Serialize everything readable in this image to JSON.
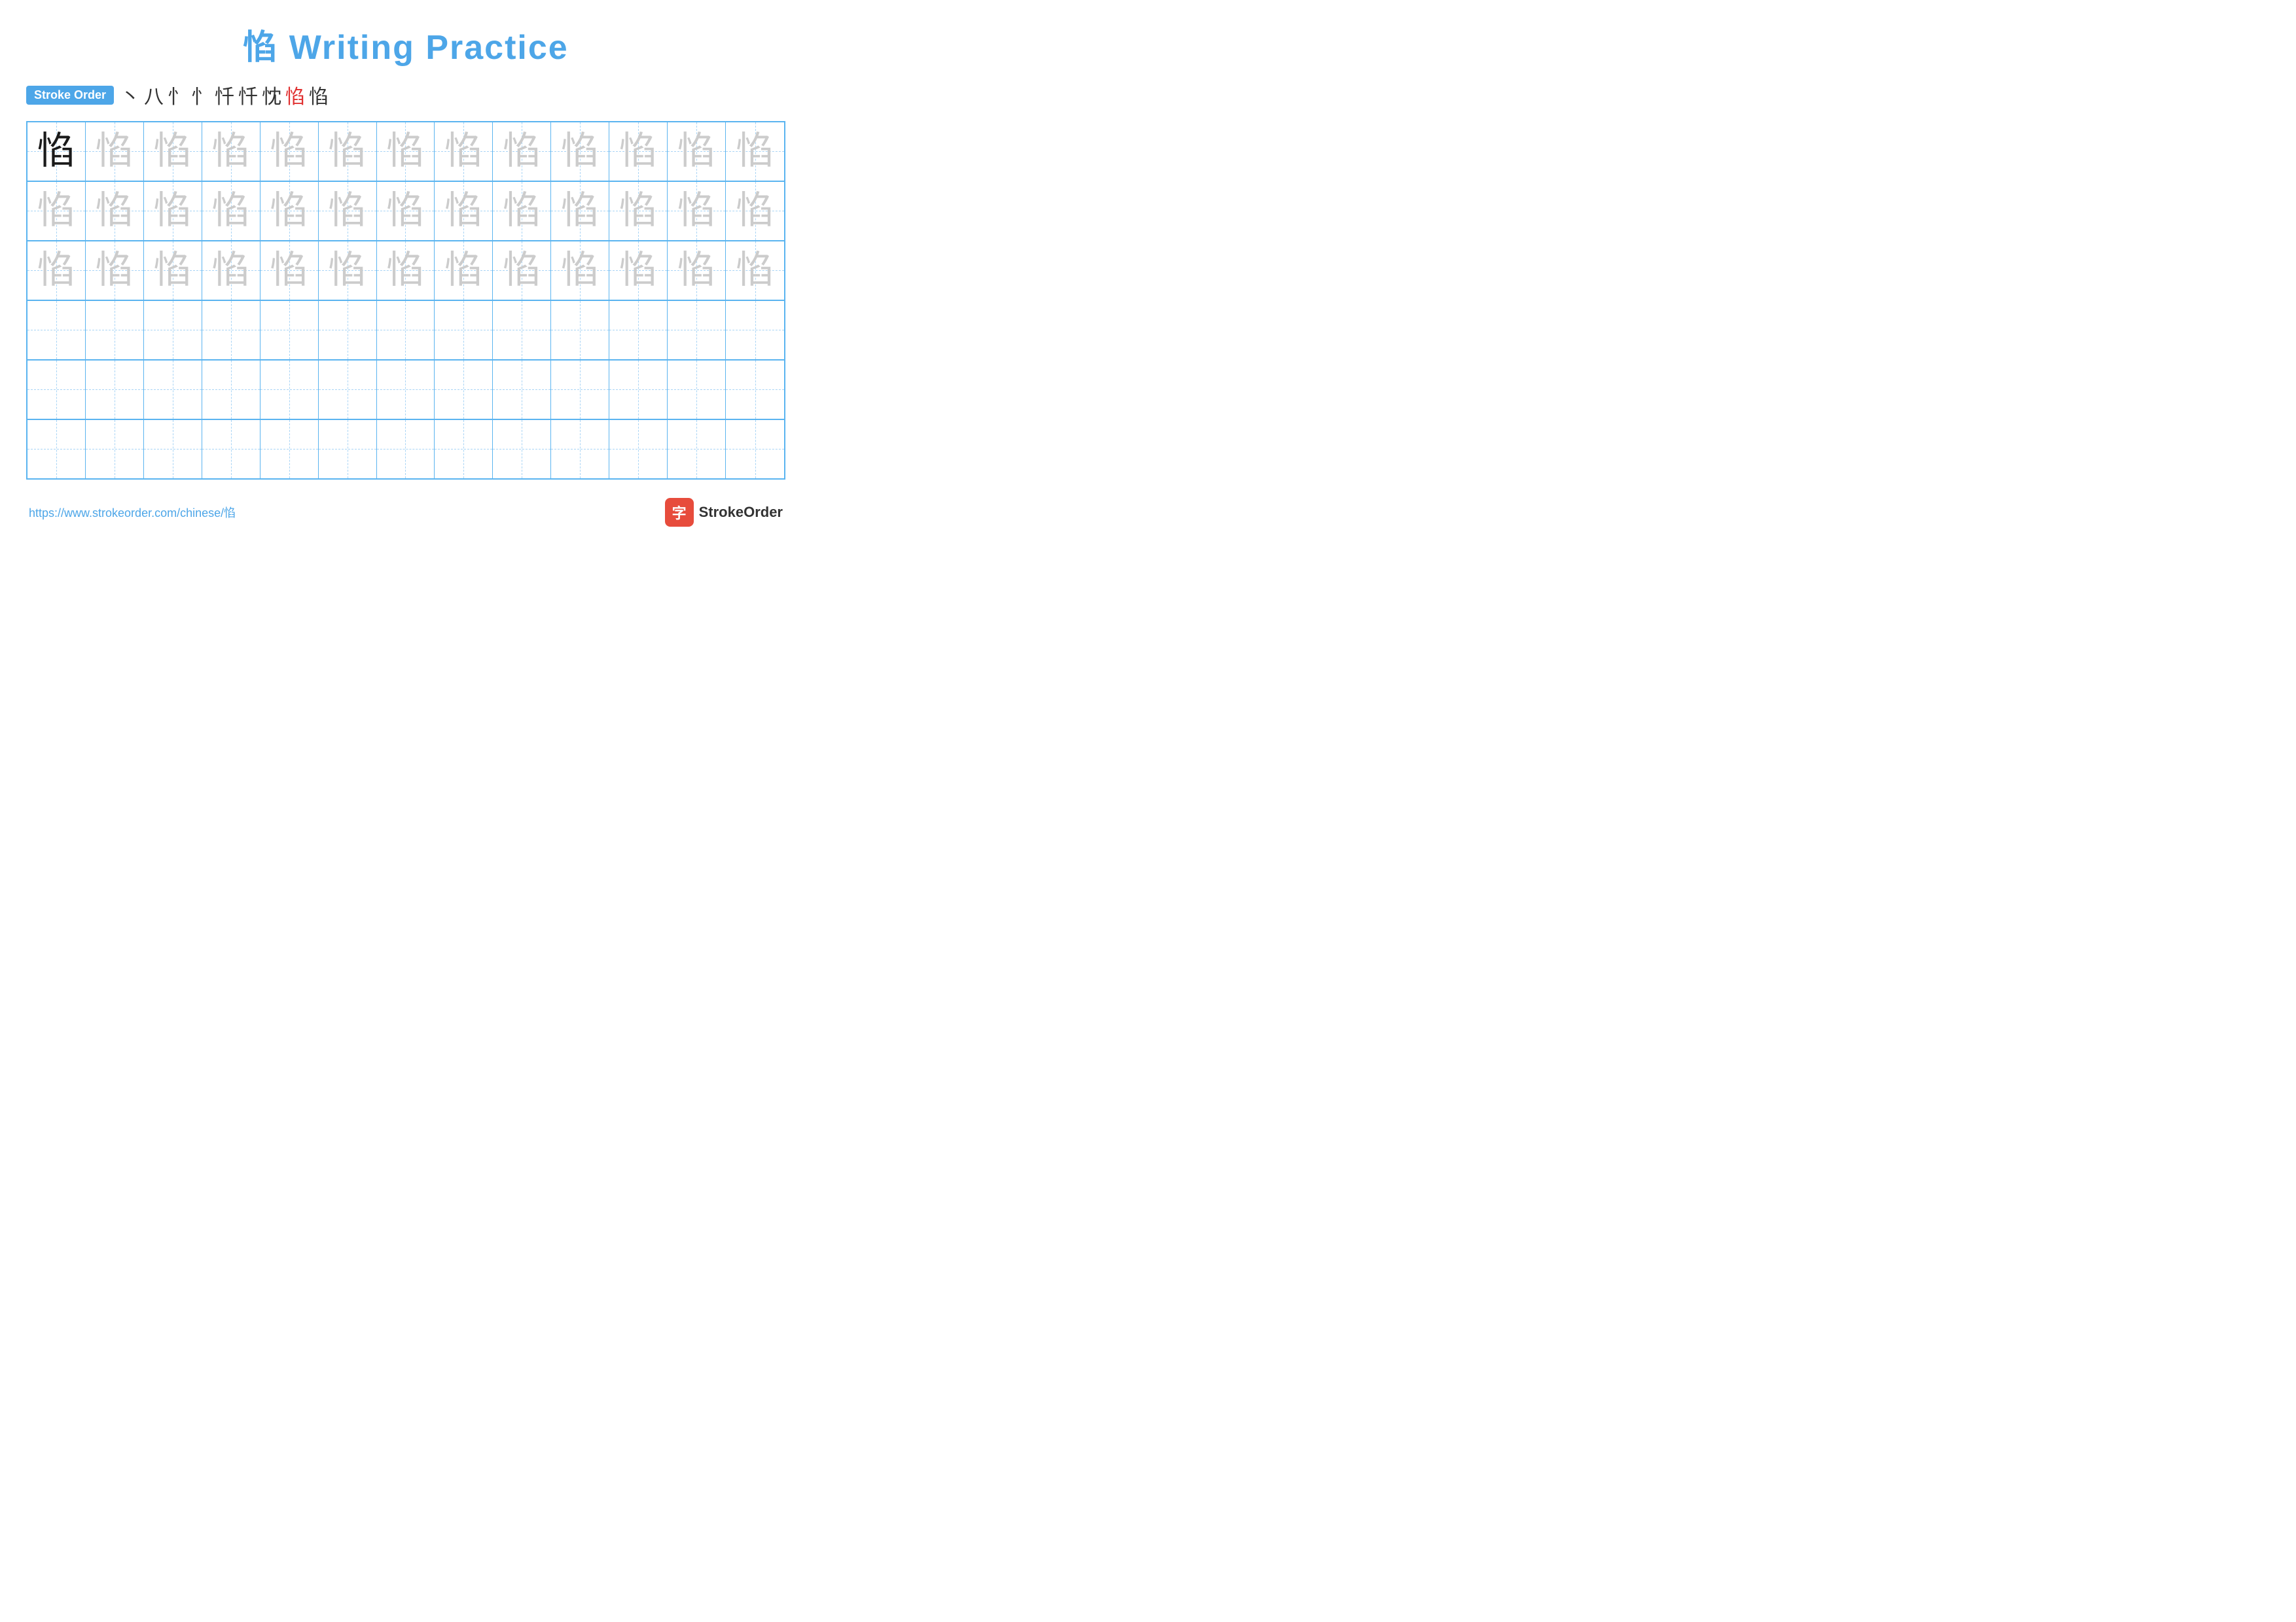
{
  "title": "惂 Writing Practice",
  "stroke_order": {
    "label": "Stroke Order",
    "strokes": [
      "丶",
      "八",
      "忄",
      "忄",
      "忏",
      "忏",
      "忱",
      "惂",
      "惂"
    ]
  },
  "character": "惂",
  "grid": {
    "rows": 6,
    "cols": 13,
    "row_types": [
      "dark-first",
      "light",
      "light",
      "empty",
      "empty",
      "empty"
    ]
  },
  "footer": {
    "url": "https://www.strokeorder.com/chinese/惂",
    "logo_text": "StrokeOrder",
    "logo_icon": "字"
  }
}
